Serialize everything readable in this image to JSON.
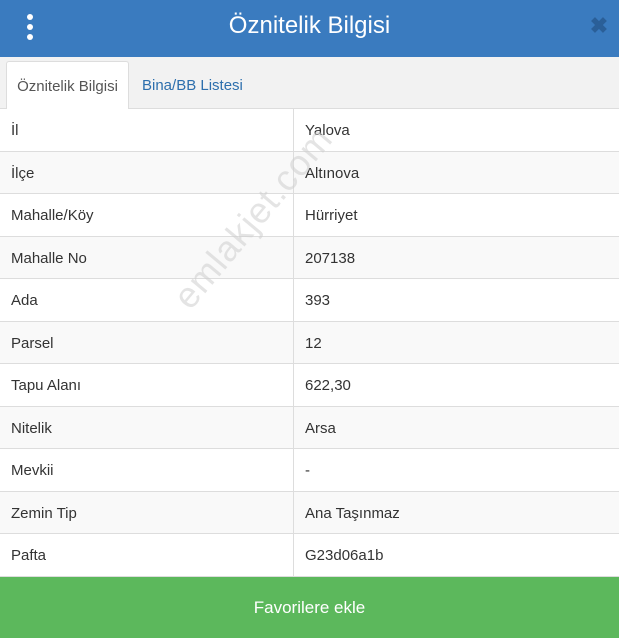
{
  "header": {
    "title": "Öznitelik Bilgisi",
    "menu_icon": "vertical-dots-icon",
    "close_icon": "close-icon",
    "close_glyph": "✖",
    "background_color": "#3a7bbf"
  },
  "tabs": [
    {
      "label": "Öznitelik Bilgisi",
      "active": true
    },
    {
      "label": "Bina/BB Listesi",
      "active": false
    }
  ],
  "attributes": [
    {
      "label": "İl",
      "value": "Yalova"
    },
    {
      "label": "İlçe",
      "value": "Altınova"
    },
    {
      "label": "Mahalle/Köy",
      "value": "Hürriyet"
    },
    {
      "label": "Mahalle No",
      "value": "207138"
    },
    {
      "label": "Ada",
      "value": "393"
    },
    {
      "label": "Parsel",
      "value": "12"
    },
    {
      "label": "Tapu Alanı",
      "value": "622,30"
    },
    {
      "label": "Nitelik",
      "value": "Arsa"
    },
    {
      "label": "Mevkii",
      "value": "-"
    },
    {
      "label": "Zemin Tip",
      "value": "Ana Taşınmaz"
    },
    {
      "label": "Pafta",
      "value": "G23d06a1b"
    }
  ],
  "watermark": "emlakjet.com",
  "footer": {
    "button_label": "Favorilere ekle",
    "button_color": "#5cb85c"
  }
}
